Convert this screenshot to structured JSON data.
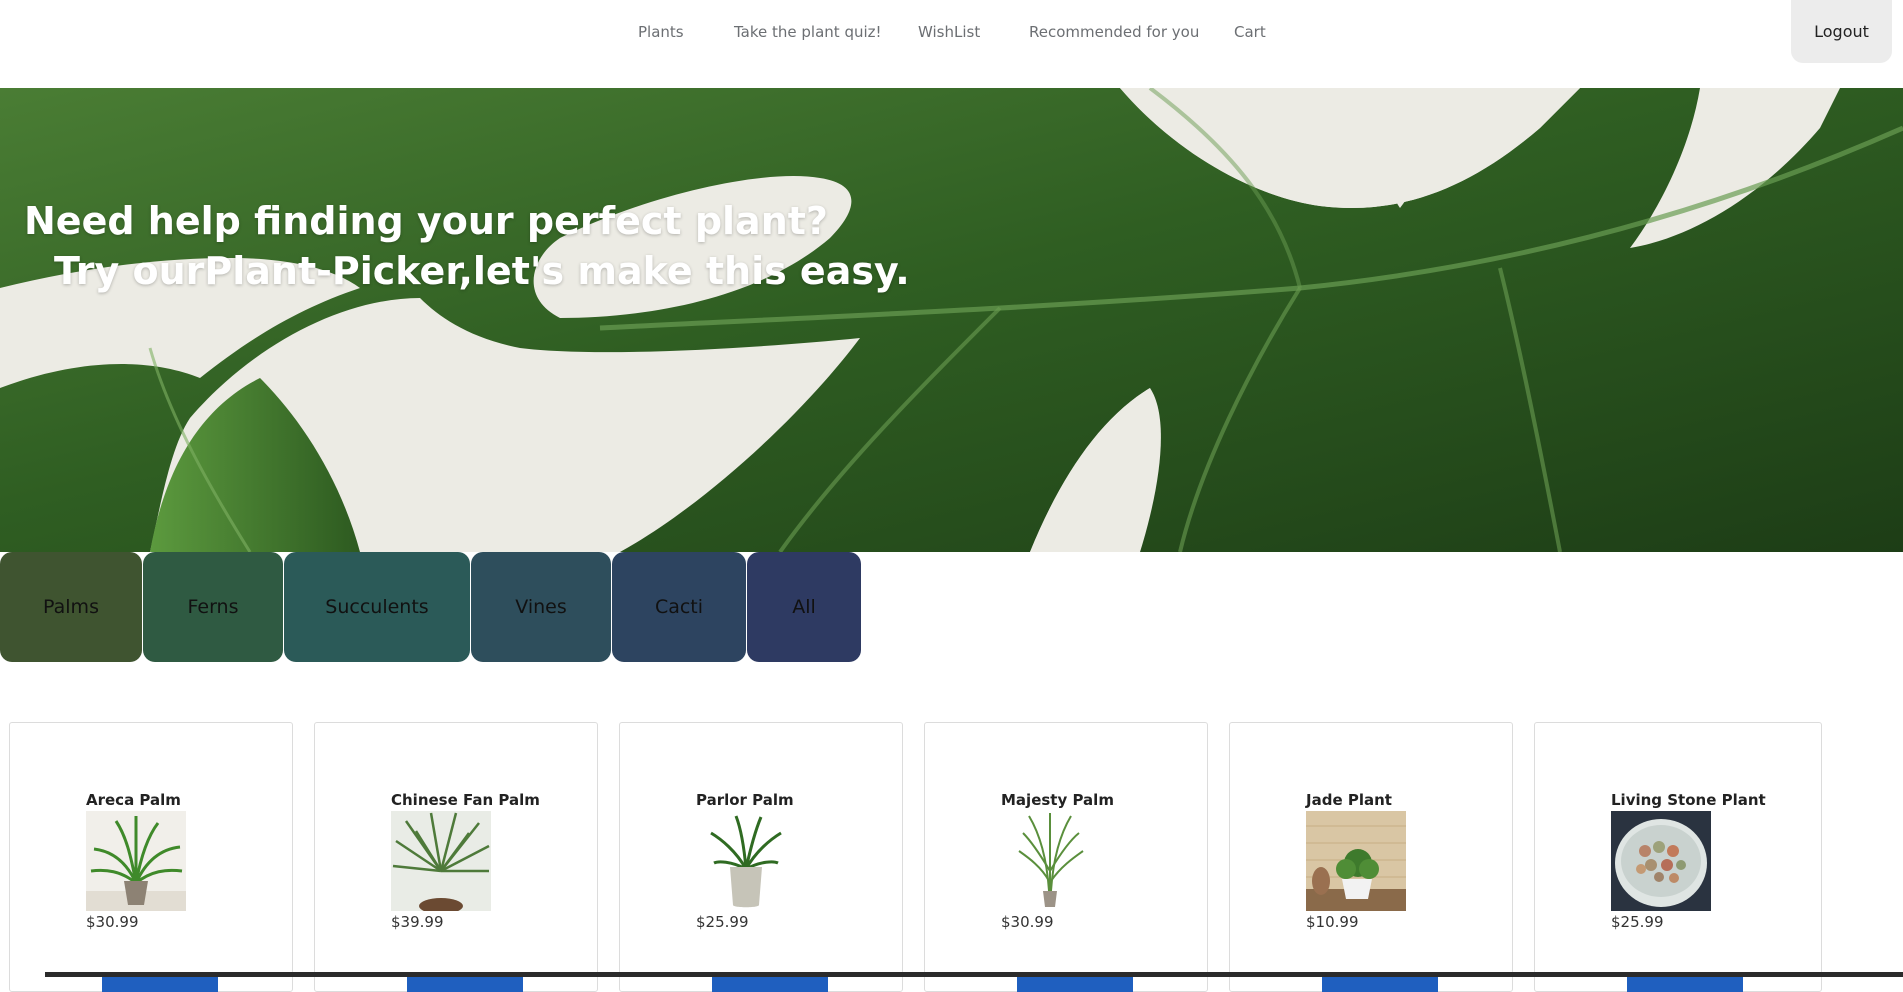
{
  "nav": {
    "links": [
      {
        "label": "Plants"
      },
      {
        "label": "Take the plant quiz!"
      },
      {
        "label": "WishList"
      },
      {
        "label": "Recommended for you"
      },
      {
        "label": "Cart"
      }
    ],
    "logout_label": "Logout"
  },
  "hero": {
    "line1": "Need help finding your perfect plant?",
    "line2": "Try ourPlant-Picker,let's make this easy."
  },
  "categories": [
    {
      "label": "Palms",
      "color": "#3f5430"
    },
    {
      "label": "Ferns",
      "color": "#2f5a42"
    },
    {
      "label": "Succulents",
      "color": "#2b5a58"
    },
    {
      "label": "Vines",
      "color": "#2e4e5c"
    },
    {
      "label": "Cacti",
      "color": "#2d4460"
    },
    {
      "label": "All",
      "color": "#2e3a62"
    }
  ],
  "products": [
    {
      "name": "Areca Palm",
      "price": "$30.99",
      "image": "areca-palm-photo"
    },
    {
      "name": "Chinese Fan Palm",
      "price": "$39.99",
      "image": "chinese-fan-palm-photo"
    },
    {
      "name": "Parlor Palm",
      "price": "$25.99",
      "image": "parlor-palm-photo"
    },
    {
      "name": "Majesty Palm",
      "price": "$30.99",
      "image": "majesty-palm-photo"
    },
    {
      "name": "Jade Plant",
      "price": "$10.99",
      "image": "jade-plant-photo"
    },
    {
      "name": "Living Stone Plant",
      "price": "$25.99",
      "image": "living-stone-plant-photo"
    }
  ],
  "colors": {
    "button_blue": "#1f5fbf",
    "logout_bg": "#ececec"
  }
}
